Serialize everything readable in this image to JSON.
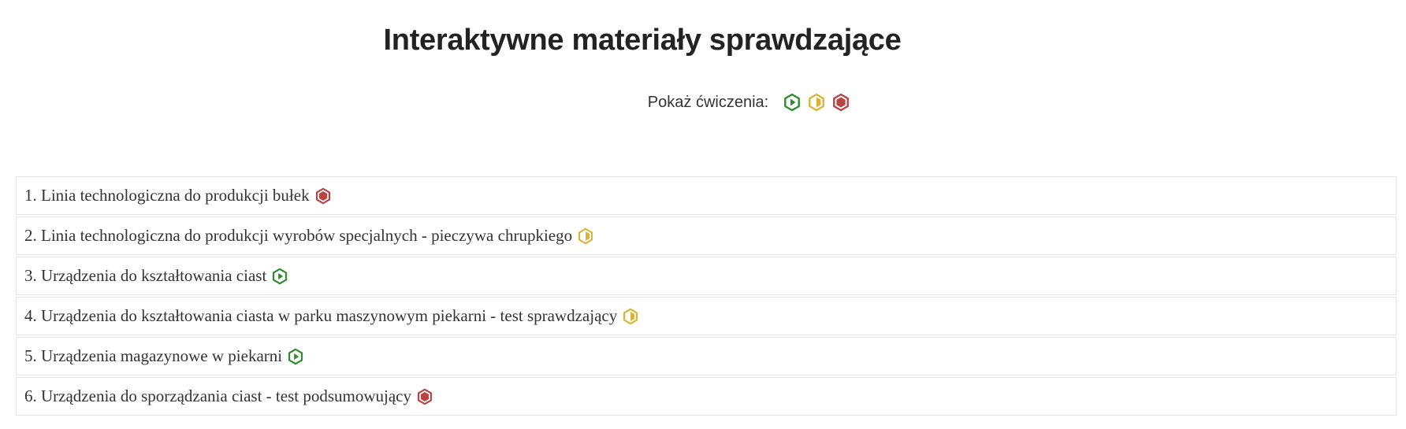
{
  "header": {
    "title": "Interaktywne materiały sprawdzające"
  },
  "filter": {
    "label": "Pokaż ćwiczenia:",
    "levels": [
      {
        "icon": "easy-level-icon",
        "color": "#2e8b2e"
      },
      {
        "icon": "medium-level-icon",
        "color": "#d9b43a"
      },
      {
        "icon": "hard-level-icon",
        "color": "#b84444"
      }
    ]
  },
  "exercises": [
    {
      "label": "1. Linia technologiczna do produkcji bułek",
      "level": "hard",
      "icon": "hard-level-icon"
    },
    {
      "label": "2. Linia technologiczna do produkcji wyrobów specjalnych - pieczywa chrupkiego",
      "level": "medium",
      "icon": "medium-level-icon"
    },
    {
      "label": "3. Urządzenia do kształtowania ciast",
      "level": "easy",
      "icon": "easy-level-icon"
    },
    {
      "label": "4. Urządzenia do kształtowania ciasta w parku maszynowym piekarni - test sprawdzający",
      "level": "medium",
      "icon": "medium-level-icon"
    },
    {
      "label": "5. Urządzenia magazynowe w piekarni",
      "level": "easy",
      "icon": "easy-level-icon"
    },
    {
      "label": "6. Urządzenia do sporządzania ciast - test podsumowujący",
      "level": "hard",
      "icon": "hard-level-icon"
    }
  ],
  "colors": {
    "easy": "#2e8b2e",
    "medium": "#d9b43a",
    "hard": "#b84444",
    "border": "#e4e4e4",
    "text": "#333333"
  }
}
